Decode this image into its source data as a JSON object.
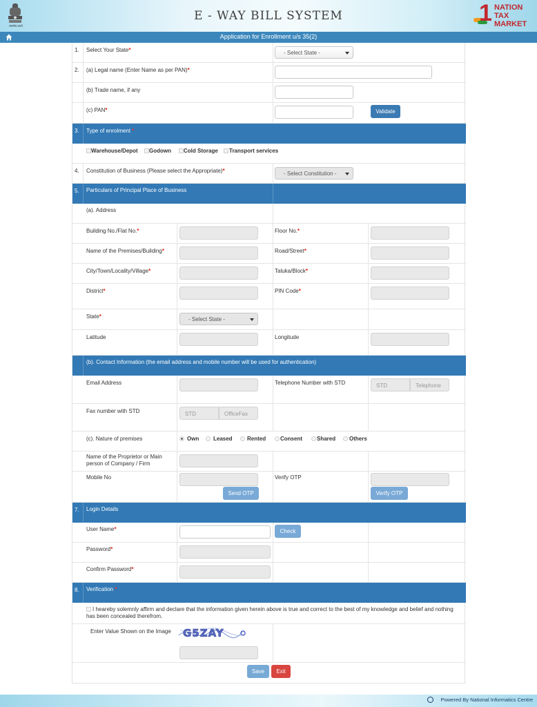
{
  "header": {
    "title": "E - WAY BILL SYSTEM",
    "emblem_caption": "सत्यमेव जयते",
    "brand": {
      "number": "1",
      "line1": "NATION",
      "line2": "TAX",
      "line3": "MARKET"
    }
  },
  "subbar": {
    "title": "Application for Enrollment u/s 35(2)"
  },
  "form": {
    "s1": {
      "num": "1.",
      "label": "Select Your State",
      "select": "- Select State -"
    },
    "s2": {
      "num": "2.",
      "legal_label": "(a) Legal name (Enter Name as per PAN)",
      "trade_label": "(b) Trade name, if any",
      "pan_label": "(c) PAN",
      "validate": "Validate"
    },
    "s3": {
      "num": "3.",
      "label": "Type of enrolment",
      "options": [
        "Warehouse/Depot",
        "Godown",
        "Cold Storage",
        "Transport services"
      ]
    },
    "s4": {
      "num": "4.",
      "label": "Constitution of Business (Please select the Appropriate)",
      "select": "- Select Constitution -"
    },
    "s5": {
      "num": "5.",
      "label": "Particulars of Principal Place of Business",
      "address_head": "(a). Address",
      "building": "Building No./Flat No.",
      "floor": "Floor No.",
      "premises": "Name of the Premises/Building",
      "road": "Road/Street",
      "city": "City/Town/Locality/Village",
      "taluka": "Taluka/Block",
      "district": "District",
      "pin": "PIN Code",
      "state": "State",
      "state_select": "- Select State -",
      "latitude": "Latitude",
      "longitude": "Longitude",
      "contact_head": "(b). Contact Information (the email address and mobile number will be used for authentication)",
      "email": "Email Address",
      "telephone": "Telephone Number with STD",
      "std_ph": "STD",
      "tel_ph": "Telephone",
      "fax": "Fax number with STD",
      "fax_std_ph": "STD",
      "fax_ph": "OfficeFax",
      "premises_nature": "(c). Nature of premises",
      "nature_options": [
        "Own",
        "Leased",
        "Rented",
        "Consent",
        "Shared",
        "Others"
      ],
      "proprietor": "Name of the Proprietor or Main person of Company / Firm",
      "mobile": "Mobile No",
      "send_otp": "Send OTP",
      "verify_otp_label": "Verify OTP",
      "verify_otp": "Verify OTP"
    },
    "s7": {
      "num": "7.",
      "label": "Login Details",
      "username": "User Name",
      "check": "Check",
      "password": "Password",
      "confirm": "Confirm Password"
    },
    "s8": {
      "num": "8.",
      "label": "Verification",
      "declaration": "I heareby solemnly affirm and declare that the information given herein above is true and correct to the best of my knowledge and belief and nothing has been concealed therefrom.",
      "captcha_label": "Enter Value Shown on the Image",
      "captcha_text": "G5ZAY"
    },
    "save": "Save",
    "exit": "Exit"
  },
  "footer": {
    "text": "Powered By National Informatics Centre"
  },
  "colors": {
    "band": "#3279b5",
    "button": "#3b7ab3",
    "exit": "#d9453f",
    "required": "#d21"
  }
}
